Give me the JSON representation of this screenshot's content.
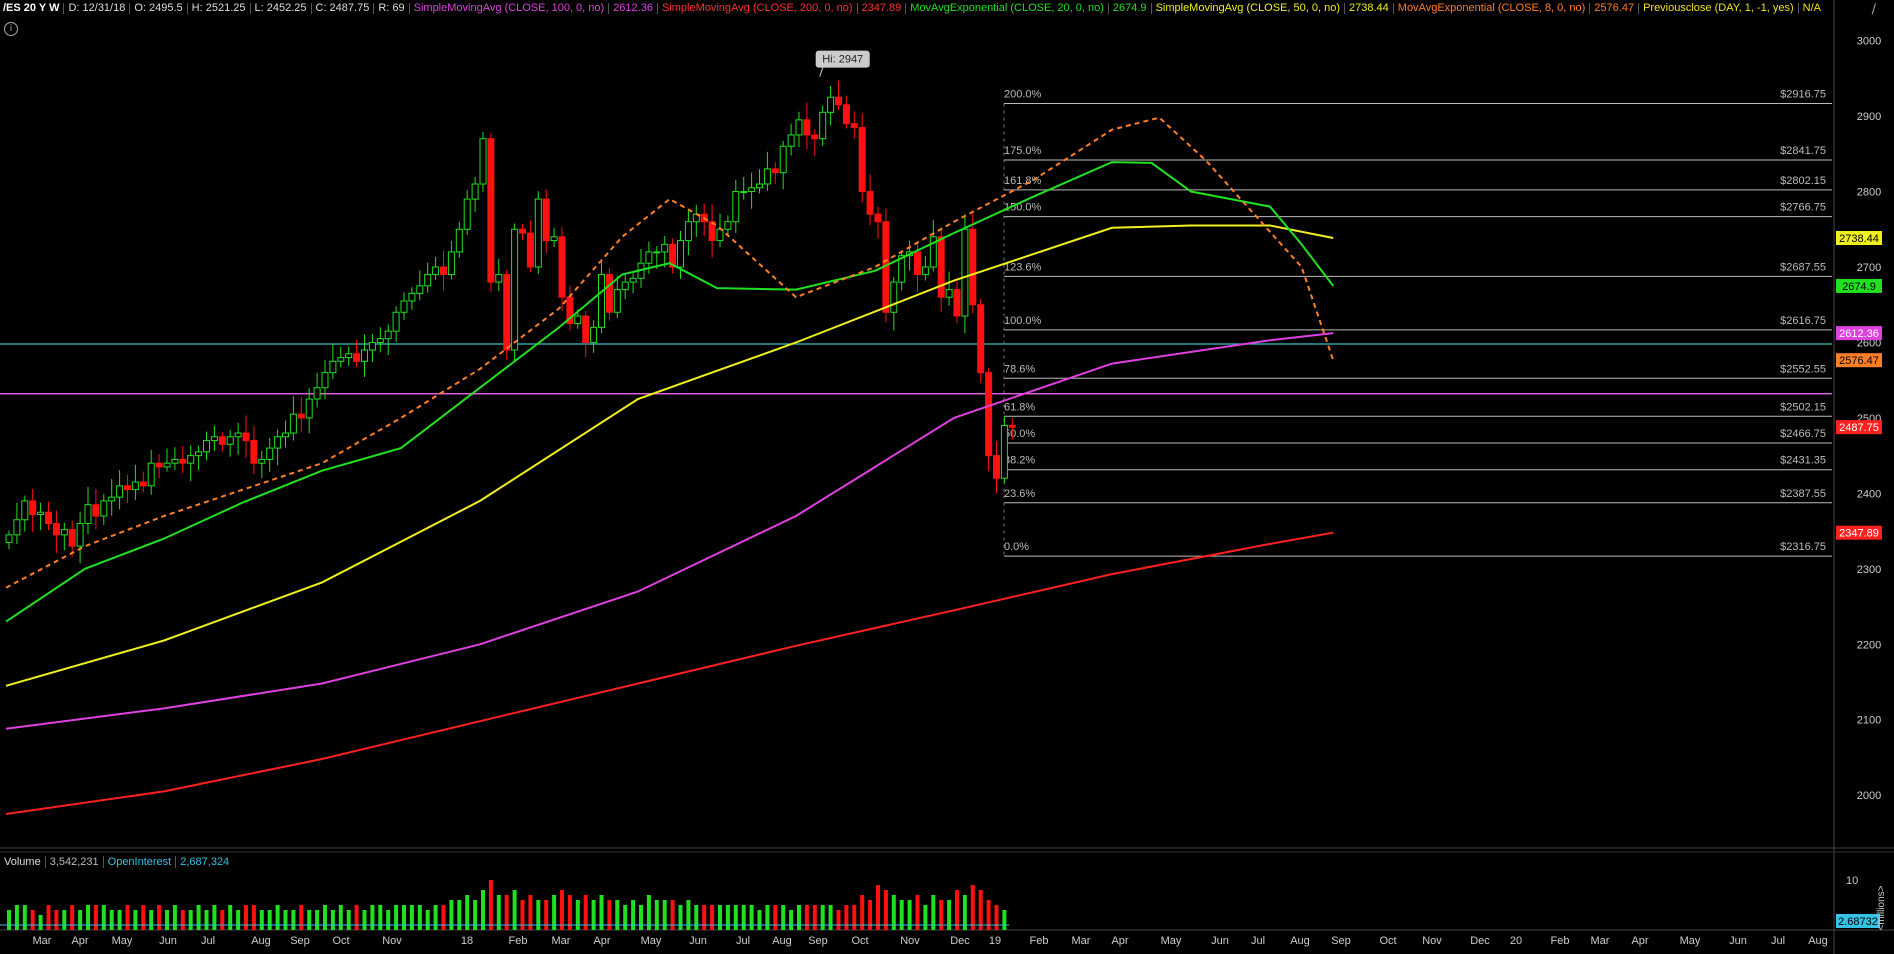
{
  "header": {
    "symbol": "/ES 20 Y W",
    "stats": [
      "D: 12/31/18",
      "O: 2495.5",
      "H: 2521.25",
      "L: 2452.25",
      "C: 2487.75",
      "R: 69"
    ],
    "studies": [
      {
        "label": "SimpleMovingAvg (CLOSE, 100, 0, no)",
        "value": "2612.36",
        "color": "#e040e0"
      },
      {
        "label": "SimpleMovingAvg (CLOSE, 200, 0, no)",
        "value": "2347.89",
        "color": "#ff2020"
      },
      {
        "label": "MovAvgExponential (CLOSE, 20, 0, no)",
        "value": "2674.9",
        "color": "#20e020"
      },
      {
        "label": "SimpleMovingAvg (CLOSE, 50, 0, no)",
        "value": "2738.44",
        "color": "#f0f020"
      },
      {
        "label": "MovAvgExponential (CLOSE, 8, 0, no)",
        "value": "2576.47",
        "color": "#ff7f27"
      },
      {
        "label": "Previousclose (DAY, 1, -1, yes)",
        "value": "N/A",
        "color": "#f0e020"
      }
    ]
  },
  "volume_header": {
    "volume_label": "Volume",
    "volume_value": "3,542,231",
    "oi_label": "OpenInterest",
    "oi_value": "2,687,324"
  },
  "chart_data": {
    "type": "candlestick",
    "ylim": [
      1930,
      3030
    ],
    "yticks": [
      "3000",
      "2900",
      "2800",
      "2700",
      "2600",
      "2500",
      "2400",
      "2300",
      "2200",
      "2100",
      "2000"
    ],
    "x_labels": [
      "Mar",
      "Apr",
      "May",
      "Jun",
      "Jul",
      "Aug",
      "Sep",
      "Oct",
      "Nov",
      "18",
      "Feb",
      "Mar",
      "Apr",
      "May",
      "Jun",
      "Jul",
      "Aug",
      "Sep",
      "Oct",
      "Nov",
      "Dec",
      "19",
      "Feb",
      "Mar",
      "Apr",
      "May",
      "Jun",
      "Jul",
      "Aug",
      "Sep",
      "Oct",
      "Nov",
      "Dec",
      "20",
      "Feb",
      "Mar",
      "Apr",
      "May",
      "Jun",
      "Jul",
      "Aug"
    ],
    "high_bubble": "Hi: 2947",
    "closes": [
      2345,
      2365,
      2390,
      2372,
      2375,
      2360,
      2345,
      2352,
      2330,
      2360,
      2385,
      2370,
      2390,
      2395,
      2410,
      2405,
      2415,
      2410,
      2440,
      2435,
      2440,
      2445,
      2440,
      2450,
      2455,
      2470,
      2475,
      2465,
      2475,
      2480,
      2470,
      2440,
      2445,
      2460,
      2475,
      2480,
      2505,
      2500,
      2525,
      2540,
      2560,
      2575,
      2580,
      2585,
      2575,
      2590,
      2600,
      2605,
      2615,
      2640,
      2655,
      2665,
      2675,
      2690,
      2700,
      2690,
      2720,
      2750,
      2790,
      2810,
      2870,
      2680,
      2690,
      2590,
      2750,
      2745,
      2700,
      2790,
      2735,
      2740,
      2660,
      2625,
      2635,
      2600,
      2620,
      2690,
      2640,
      2670,
      2680,
      2685,
      2705,
      2720,
      2720,
      2730,
      2700,
      2735,
      2760,
      2770,
      2760,
      2735,
      2750,
      2760,
      2800,
      2800,
      2805,
      2810,
      2830,
      2825,
      2860,
      2875,
      2895,
      2875,
      2870,
      2905,
      2925,
      2915,
      2890,
      2885,
      2800,
      2770,
      2760,
      2640,
      2680,
      2715,
      2720,
      2690,
      2700,
      2740,
      2660,
      2670,
      2635,
      2750,
      2650,
      2560,
      2450,
      2420,
      2490,
      2487.75
    ],
    "volume_values": [
      4,
      5,
      5,
      4,
      3,
      5,
      4,
      4,
      5,
      4,
      5,
      5,
      5,
      4,
      4,
      5,
      4,
      5,
      4,
      5,
      4,
      5,
      4,
      4,
      5,
      4,
      5,
      4,
      5,
      4,
      5,
      5,
      4,
      4,
      5,
      4,
      4,
      5,
      4,
      4,
      5,
      4,
      5,
      4,
      5,
      4,
      5,
      5,
      4,
      5,
      5,
      5,
      5,
      4,
      5,
      5,
      6,
      6,
      7,
      6,
      8,
      10,
      7,
      7,
      8,
      6,
      7,
      6,
      6,
      7,
      8,
      7,
      6,
      7,
      6,
      7,
      6,
      6,
      5,
      6,
      5,
      7,
      6,
      6,
      6,
      5,
      6,
      5,
      5,
      5,
      5,
      5,
      5,
      5,
      5,
      4,
      5,
      5,
      5,
      4,
      5,
      5,
      5,
      5,
      5,
      4,
      5,
      5,
      7,
      6,
      9,
      8,
      7,
      6,
      6,
      7,
      5,
      7,
      6,
      6,
      8,
      7,
      9,
      8,
      6,
      5,
      4
    ],
    "vol_ylim": [
      0,
      12
    ],
    "vol_tick": "10",
    "vol_unit": "<millions>",
    "vol_current": "2.68732",
    "horizontal_lines": [
      {
        "value": 2598,
        "color": "#36c2c2"
      },
      {
        "value": 2532,
        "color": "#ff70ff"
      }
    ],
    "fib_levels": [
      {
        "pct": "200.0%",
        "value": 2916.75,
        "label": "$2916.75"
      },
      {
        "pct": "175.0%",
        "value": 2841.75,
        "label": "$2841.75"
      },
      {
        "pct": "161.8%",
        "value": 2802.15,
        "label": "$2802.15"
      },
      {
        "pct": "150.0%",
        "value": 2766.75,
        "label": "$2766.75"
      },
      {
        "pct": "123.6%",
        "value": 2687.55,
        "label": "$2687.55"
      },
      {
        "pct": "100.0%",
        "value": 2616.75,
        "label": "$2616.75"
      },
      {
        "pct": "78.6%",
        "value": 2552.55,
        "label": "$2552.55"
      },
      {
        "pct": "61.8%",
        "value": 2502.15,
        "label": "$2502.15"
      },
      {
        "pct": "50.0%",
        "value": 2466.75,
        "label": "$2466.75"
      },
      {
        "pct": "38.2%",
        "value": 2431.35,
        "label": "$2431.35"
      },
      {
        "pct": "23.6%",
        "value": 2387.55,
        "label": "$2387.55"
      },
      {
        "pct": "0.0%",
        "value": 2316.75,
        "label": "$2316.75"
      }
    ],
    "price_badges": [
      {
        "value": 2738.44,
        "label": "2738.44",
        "bg": "#f0f020",
        "fg": "#000"
      },
      {
        "value": 2674.9,
        "label": "2674.9",
        "bg": "#20e020",
        "fg": "#000"
      },
      {
        "value": 2612.36,
        "label": "2612.36",
        "bg": "#e040e0",
        "fg": "#fff"
      },
      {
        "value": 2576.47,
        "label": "2576.47",
        "bg": "#ff7f27",
        "fg": "#000"
      },
      {
        "value": 2487.75,
        "label": "2487.75",
        "bg": "#ff2020",
        "fg": "#fff"
      },
      {
        "value": 2347.89,
        "label": "2347.89",
        "bg": "#ff2020",
        "fg": "#fff"
      }
    ],
    "ma_series": [
      {
        "key": "sma100",
        "color": "#e040e0",
        "points": [
          [
            0,
            2088
          ],
          [
            20,
            2115
          ],
          [
            40,
            2148
          ],
          [
            60,
            2200
          ],
          [
            80,
            2270
          ],
          [
            100,
            2370
          ],
          [
            120,
            2500
          ],
          [
            140,
            2572
          ],
          [
            160,
            2603
          ],
          [
            168,
            2612.36
          ]
        ]
      },
      {
        "key": "sma200",
        "color": "#ff2020",
        "points": [
          [
            0,
            1975
          ],
          [
            20,
            2005
          ],
          [
            40,
            2048
          ],
          [
            60,
            2098
          ],
          [
            80,
            2148
          ],
          [
            100,
            2198
          ],
          [
            120,
            2245
          ],
          [
            140,
            2293
          ],
          [
            160,
            2333
          ],
          [
            168,
            2347.89
          ]
        ]
      },
      {
        "key": "sma50",
        "color": "#f0f020",
        "points": [
          [
            0,
            2145
          ],
          [
            20,
            2205
          ],
          [
            40,
            2282
          ],
          [
            60,
            2390
          ],
          [
            80,
            2525
          ],
          [
            100,
            2600
          ],
          [
            120,
            2682
          ],
          [
            140,
            2752
          ],
          [
            150,
            2755
          ],
          [
            160,
            2755
          ],
          [
            168,
            2738.44
          ]
        ]
      },
      {
        "key": "ema20",
        "color": "#20e020",
        "points": [
          [
            0,
            2230
          ],
          [
            10,
            2300
          ],
          [
            20,
            2340
          ],
          [
            30,
            2388
          ],
          [
            40,
            2430
          ],
          [
            50,
            2460
          ],
          [
            60,
            2540
          ],
          [
            70,
            2620
          ],
          [
            78,
            2690
          ],
          [
            84,
            2705
          ],
          [
            90,
            2672
          ],
          [
            100,
            2670
          ],
          [
            110,
            2695
          ],
          [
            120,
            2745
          ],
          [
            130,
            2793
          ],
          [
            140,
            2839
          ],
          [
            145,
            2838
          ],
          [
            150,
            2800
          ],
          [
            160,
            2780
          ],
          [
            164,
            2730
          ],
          [
            168,
            2674.9
          ]
        ]
      },
      {
        "key": "ema8",
        "color": "#ff7f27",
        "dashed": true,
        "points": [
          [
            0,
            2275
          ],
          [
            10,
            2330
          ],
          [
            20,
            2370
          ],
          [
            30,
            2405
          ],
          [
            40,
            2440
          ],
          [
            50,
            2500
          ],
          [
            60,
            2565
          ],
          [
            70,
            2645
          ],
          [
            78,
            2740
          ],
          [
            84,
            2790
          ],
          [
            90,
            2755
          ],
          [
            100,
            2660
          ],
          [
            110,
            2700
          ],
          [
            120,
            2760
          ],
          [
            130,
            2815
          ],
          [
            140,
            2882
          ],
          [
            146,
            2898
          ],
          [
            152,
            2840
          ],
          [
            158,
            2770
          ],
          [
            164,
            2700
          ],
          [
            168,
            2576.47
          ]
        ]
      }
    ]
  }
}
